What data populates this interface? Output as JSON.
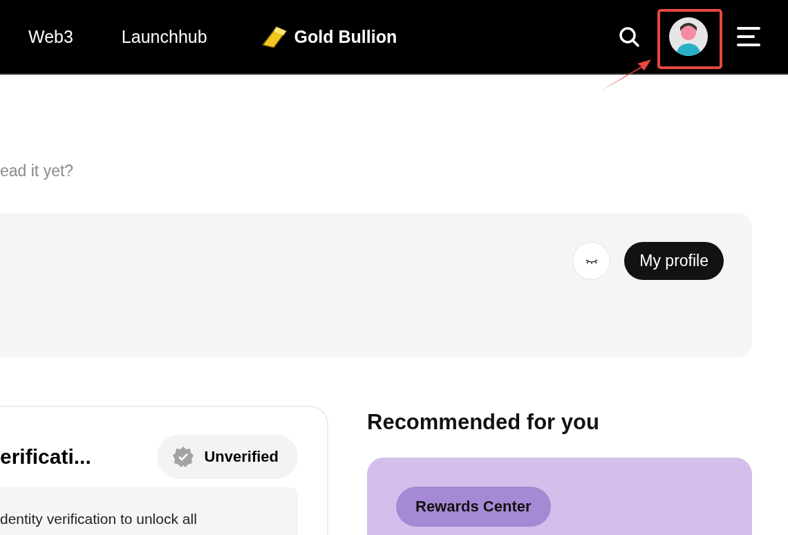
{
  "nav": {
    "items": [
      {
        "label": "Web3",
        "kind": "plain"
      },
      {
        "label": "Launchhub",
        "kind": "plain"
      },
      {
        "label": "Gold Bullion",
        "kind": "featured"
      }
    ]
  },
  "prompt": "ead it yet?",
  "profile_panel": {
    "button": "My profile"
  },
  "verification_card": {
    "title": "erificati...",
    "status": "Unverified",
    "message": "dentity verification to unlock all"
  },
  "recommended": {
    "heading": "Recommended for you",
    "card": {
      "tag": "Rewards Center"
    }
  }
}
